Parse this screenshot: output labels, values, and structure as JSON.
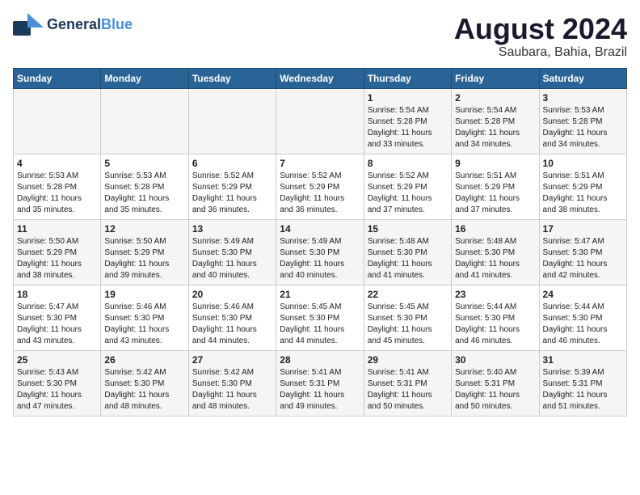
{
  "logo": {
    "line1": "General",
    "line2": "Blue",
    "tagline": ""
  },
  "title": "August 2024",
  "subtitle": "Saubara, Bahia, Brazil",
  "weekdays": [
    "Sunday",
    "Monday",
    "Tuesday",
    "Wednesday",
    "Thursday",
    "Friday",
    "Saturday"
  ],
  "weeks": [
    [
      {
        "day": "",
        "info": ""
      },
      {
        "day": "",
        "info": ""
      },
      {
        "day": "",
        "info": ""
      },
      {
        "day": "",
        "info": ""
      },
      {
        "day": "1",
        "info": "Sunrise: 5:54 AM\nSunset: 5:28 PM\nDaylight: 11 hours\nand 33 minutes."
      },
      {
        "day": "2",
        "info": "Sunrise: 5:54 AM\nSunset: 5:28 PM\nDaylight: 11 hours\nand 34 minutes."
      },
      {
        "day": "3",
        "info": "Sunrise: 5:53 AM\nSunset: 5:28 PM\nDaylight: 11 hours\nand 34 minutes."
      }
    ],
    [
      {
        "day": "4",
        "info": "Sunrise: 5:53 AM\nSunset: 5:28 PM\nDaylight: 11 hours\nand 35 minutes."
      },
      {
        "day": "5",
        "info": "Sunrise: 5:53 AM\nSunset: 5:28 PM\nDaylight: 11 hours\nand 35 minutes."
      },
      {
        "day": "6",
        "info": "Sunrise: 5:52 AM\nSunset: 5:29 PM\nDaylight: 11 hours\nand 36 minutes."
      },
      {
        "day": "7",
        "info": "Sunrise: 5:52 AM\nSunset: 5:29 PM\nDaylight: 11 hours\nand 36 minutes."
      },
      {
        "day": "8",
        "info": "Sunrise: 5:52 AM\nSunset: 5:29 PM\nDaylight: 11 hours\nand 37 minutes."
      },
      {
        "day": "9",
        "info": "Sunrise: 5:51 AM\nSunset: 5:29 PM\nDaylight: 11 hours\nand 37 minutes."
      },
      {
        "day": "10",
        "info": "Sunrise: 5:51 AM\nSunset: 5:29 PM\nDaylight: 11 hours\nand 38 minutes."
      }
    ],
    [
      {
        "day": "11",
        "info": "Sunrise: 5:50 AM\nSunset: 5:29 PM\nDaylight: 11 hours\nand 38 minutes."
      },
      {
        "day": "12",
        "info": "Sunrise: 5:50 AM\nSunset: 5:29 PM\nDaylight: 11 hours\nand 39 minutes."
      },
      {
        "day": "13",
        "info": "Sunrise: 5:49 AM\nSunset: 5:30 PM\nDaylight: 11 hours\nand 40 minutes."
      },
      {
        "day": "14",
        "info": "Sunrise: 5:49 AM\nSunset: 5:30 PM\nDaylight: 11 hours\nand 40 minutes."
      },
      {
        "day": "15",
        "info": "Sunrise: 5:48 AM\nSunset: 5:30 PM\nDaylight: 11 hours\nand 41 minutes."
      },
      {
        "day": "16",
        "info": "Sunrise: 5:48 AM\nSunset: 5:30 PM\nDaylight: 11 hours\nand 41 minutes."
      },
      {
        "day": "17",
        "info": "Sunrise: 5:47 AM\nSunset: 5:30 PM\nDaylight: 11 hours\nand 42 minutes."
      }
    ],
    [
      {
        "day": "18",
        "info": "Sunrise: 5:47 AM\nSunset: 5:30 PM\nDaylight: 11 hours\nand 43 minutes."
      },
      {
        "day": "19",
        "info": "Sunrise: 5:46 AM\nSunset: 5:30 PM\nDaylight: 11 hours\nand 43 minutes."
      },
      {
        "day": "20",
        "info": "Sunrise: 5:46 AM\nSunset: 5:30 PM\nDaylight: 11 hours\nand 44 minutes."
      },
      {
        "day": "21",
        "info": "Sunrise: 5:45 AM\nSunset: 5:30 PM\nDaylight: 11 hours\nand 44 minutes."
      },
      {
        "day": "22",
        "info": "Sunrise: 5:45 AM\nSunset: 5:30 PM\nDaylight: 11 hours\nand 45 minutes."
      },
      {
        "day": "23",
        "info": "Sunrise: 5:44 AM\nSunset: 5:30 PM\nDaylight: 11 hours\nand 46 minutes."
      },
      {
        "day": "24",
        "info": "Sunrise: 5:44 AM\nSunset: 5:30 PM\nDaylight: 11 hours\nand 46 minutes."
      }
    ],
    [
      {
        "day": "25",
        "info": "Sunrise: 5:43 AM\nSunset: 5:30 PM\nDaylight: 11 hours\nand 47 minutes."
      },
      {
        "day": "26",
        "info": "Sunrise: 5:42 AM\nSunset: 5:30 PM\nDaylight: 11 hours\nand 48 minutes."
      },
      {
        "day": "27",
        "info": "Sunrise: 5:42 AM\nSunset: 5:30 PM\nDaylight: 11 hours\nand 48 minutes."
      },
      {
        "day": "28",
        "info": "Sunrise: 5:41 AM\nSunset: 5:31 PM\nDaylight: 11 hours\nand 49 minutes."
      },
      {
        "day": "29",
        "info": "Sunrise: 5:41 AM\nSunset: 5:31 PM\nDaylight: 11 hours\nand 50 minutes."
      },
      {
        "day": "30",
        "info": "Sunrise: 5:40 AM\nSunset: 5:31 PM\nDaylight: 11 hours\nand 50 minutes."
      },
      {
        "day": "31",
        "info": "Sunrise: 5:39 AM\nSunset: 5:31 PM\nDaylight: 11 hours\nand 51 minutes."
      }
    ]
  ]
}
